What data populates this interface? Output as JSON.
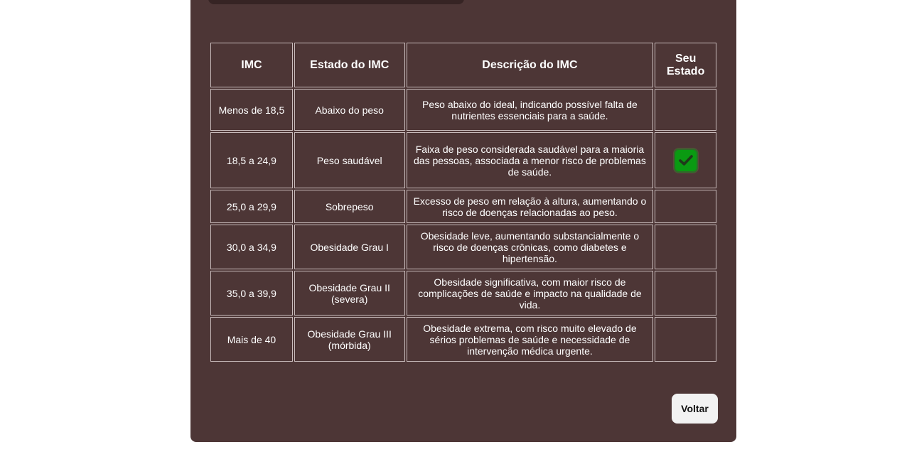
{
  "table": {
    "headers": [
      "IMC",
      "Estado do IMC",
      "Descrição do IMC",
      "Seu Estado"
    ],
    "rows": [
      {
        "imc": "Menos de 18,5",
        "estado": "Abaixo do peso",
        "descricao": "Peso abaixo do ideal, indicando possível falta de nutrientes essenciais para a saúde.",
        "selected": false
      },
      {
        "imc": "18,5 a 24,9",
        "estado": "Peso saudável",
        "descricao": "Faixa de peso considerada saudável para a maioria das pessoas, associada a menor risco de problemas de saúde.",
        "selected": true
      },
      {
        "imc": "25,0 a 29,9",
        "estado": "Sobrepeso",
        "descricao": "Excesso de peso em relação à altura, aumentando o risco de doenças relacionadas ao peso.",
        "selected": false
      },
      {
        "imc": "30,0 a 34,9",
        "estado": "Obesidade Grau I",
        "descricao": "Obesidade leve, aumentando substancialmente o risco de doenças crônicas, como diabetes e hipertensão.",
        "selected": false
      },
      {
        "imc": "35,0 a 39,9",
        "estado": "Obesidade Grau II (severa)",
        "descricao": "Obesidade significativa, com maior risco de complicações de saúde e impacto na qualidade de vida.",
        "selected": false
      },
      {
        "imc": "Mais de 40",
        "estado": "Obesidade Grau III (mórbida)",
        "descricao": "Obesidade extrema, com risco muito elevado de sérios problemas de saúde e necessidade de intervenção médica urgente.",
        "selected": false
      }
    ]
  },
  "check_icon": "check-icon",
  "colors": {
    "card_background": "#4d3636",
    "check_green": "#0a9a12"
  },
  "buttons": {
    "back_label": "Voltar"
  }
}
